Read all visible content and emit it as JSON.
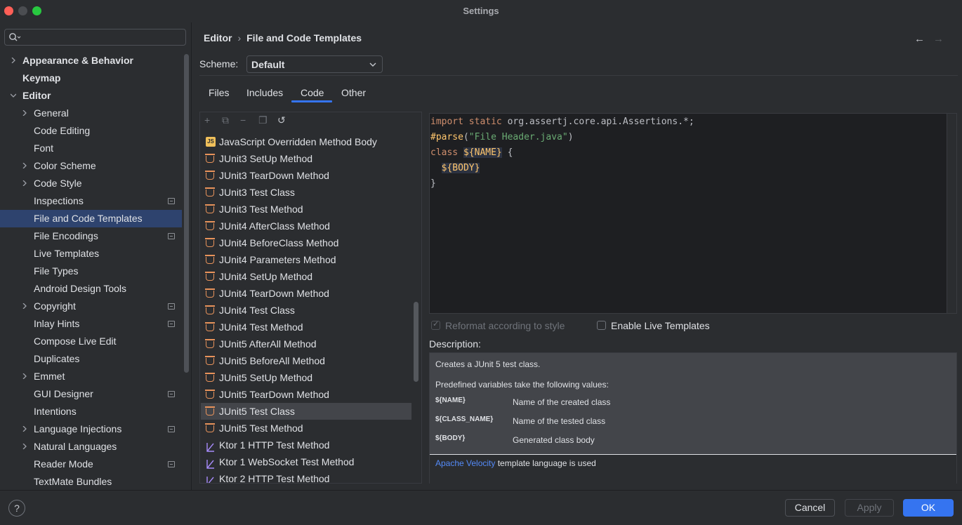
{
  "window": {
    "title": "Settings"
  },
  "colors": {
    "accent": "#3574f0",
    "selection": "#2e436e",
    "link": "#548af7"
  },
  "sidebar": {
    "search_placeholder": "",
    "items": [
      {
        "label": "Appearance & Behavior",
        "expandable": true,
        "expanded": false,
        "bold": true
      },
      {
        "label": "Keymap",
        "bold": true
      },
      {
        "label": "Editor",
        "expandable": true,
        "expanded": true,
        "bold": true
      },
      {
        "label": "General",
        "expandable": true
      },
      {
        "label": "Code Editing"
      },
      {
        "label": "Font"
      },
      {
        "label": "Color Scheme",
        "expandable": true
      },
      {
        "label": "Code Style",
        "expandable": true
      },
      {
        "label": "Inspections",
        "badge": true
      },
      {
        "label": "File and Code Templates",
        "selected": true
      },
      {
        "label": "File Encodings",
        "badge": true
      },
      {
        "label": "Live Templates"
      },
      {
        "label": "File Types"
      },
      {
        "label": "Android Design Tools"
      },
      {
        "label": "Copyright",
        "expandable": true,
        "badge": true
      },
      {
        "label": "Inlay Hints",
        "badge": true
      },
      {
        "label": "Compose Live Edit"
      },
      {
        "label": "Duplicates"
      },
      {
        "label": "Emmet",
        "expandable": true
      },
      {
        "label": "GUI Designer",
        "badge": true
      },
      {
        "label": "Intentions"
      },
      {
        "label": "Language Injections",
        "expandable": true,
        "badge": true
      },
      {
        "label": "Natural Languages",
        "expandable": true
      },
      {
        "label": "Reader Mode",
        "badge": true
      },
      {
        "label": "TextMate Bundles"
      }
    ]
  },
  "breadcrumb": {
    "parent": "Editor",
    "separator": "›",
    "current": "File and Code Templates"
  },
  "nav": {
    "back": "←",
    "forward": "→"
  },
  "scheme": {
    "label": "Scheme:",
    "value": "Default"
  },
  "tabs": [
    {
      "label": "Files"
    },
    {
      "label": "Includes"
    },
    {
      "label": "Code",
      "active": true
    },
    {
      "label": "Other"
    }
  ],
  "list_toolbar": {
    "add": "+",
    "add_child": "⧉",
    "remove": "−",
    "copy": "❐",
    "reset": "↺"
  },
  "templates": [
    {
      "label": "JavaScript Overridden Method Body",
      "icon": "js-icon"
    },
    {
      "label": "JUnit3 SetUp Method",
      "icon": "java-cup-icon"
    },
    {
      "label": "JUnit3 TearDown Method",
      "icon": "java-cup-icon"
    },
    {
      "label": "JUnit3 Test Class",
      "icon": "java-cup-icon"
    },
    {
      "label": "JUnit3 Test Method",
      "icon": "java-cup-icon"
    },
    {
      "label": "JUnit4 AfterClass Method",
      "icon": "java-cup-icon"
    },
    {
      "label": "JUnit4 BeforeClass Method",
      "icon": "java-cup-icon"
    },
    {
      "label": "JUnit4 Parameters Method",
      "icon": "java-cup-icon"
    },
    {
      "label": "JUnit4 SetUp Method",
      "icon": "java-cup-icon"
    },
    {
      "label": "JUnit4 TearDown Method",
      "icon": "java-cup-icon"
    },
    {
      "label": "JUnit4 Test Class",
      "icon": "java-cup-icon"
    },
    {
      "label": "JUnit4 Test Method",
      "icon": "java-cup-icon"
    },
    {
      "label": "JUnit5 AfterAll Method",
      "icon": "java-cup-icon"
    },
    {
      "label": "JUnit5 BeforeAll Method",
      "icon": "java-cup-icon"
    },
    {
      "label": "JUnit5 SetUp Method",
      "icon": "java-cup-icon"
    },
    {
      "label": "JUnit5 TearDown Method",
      "icon": "java-cup-icon"
    },
    {
      "label": "JUnit5 Test Class",
      "icon": "java-cup-icon",
      "selected": true
    },
    {
      "label": "JUnit5 Test Method",
      "icon": "java-cup-icon"
    },
    {
      "label": "Ktor 1 HTTP Test Method",
      "icon": "ktor-icon"
    },
    {
      "label": "Ktor 1 WebSocket Test Method",
      "icon": "ktor-icon"
    },
    {
      "label": "Ktor 2 HTTP Test Method",
      "icon": "ktor-icon"
    }
  ],
  "code": {
    "line1_kw": "import static",
    "line1_rest": " org.assertj.core.api.Assertions.*;",
    "line2_dir": "#parse",
    "line2_open": "(",
    "line2_str": "\"File Header.java\"",
    "line2_close": ")",
    "line3_kw": "class",
    "line3_var": "${NAME}",
    "line3_rest": " {",
    "line4_var": "${BODY}",
    "line5": "}"
  },
  "options": {
    "reformat_label": "Reformat according to style",
    "reformat_checked": true,
    "live_templates_label": "Enable Live Templates",
    "live_templates_checked": false
  },
  "description": {
    "label": "Description:",
    "intro": "Creates a JUnit 5 test class.",
    "vars_intro": "Predefined variables take the following values:",
    "vars": [
      {
        "name": "${NAME}",
        "value": "Name of the created class"
      },
      {
        "name": "${CLASS_NAME}",
        "value": "Name of the tested class"
      },
      {
        "name": "${BODY}",
        "value": "Generated class body"
      }
    ],
    "footer_link": "Apache Velocity",
    "footer_text": " template language is used"
  },
  "footer": {
    "help": "?",
    "cancel": "Cancel",
    "apply": "Apply",
    "ok": "OK"
  }
}
